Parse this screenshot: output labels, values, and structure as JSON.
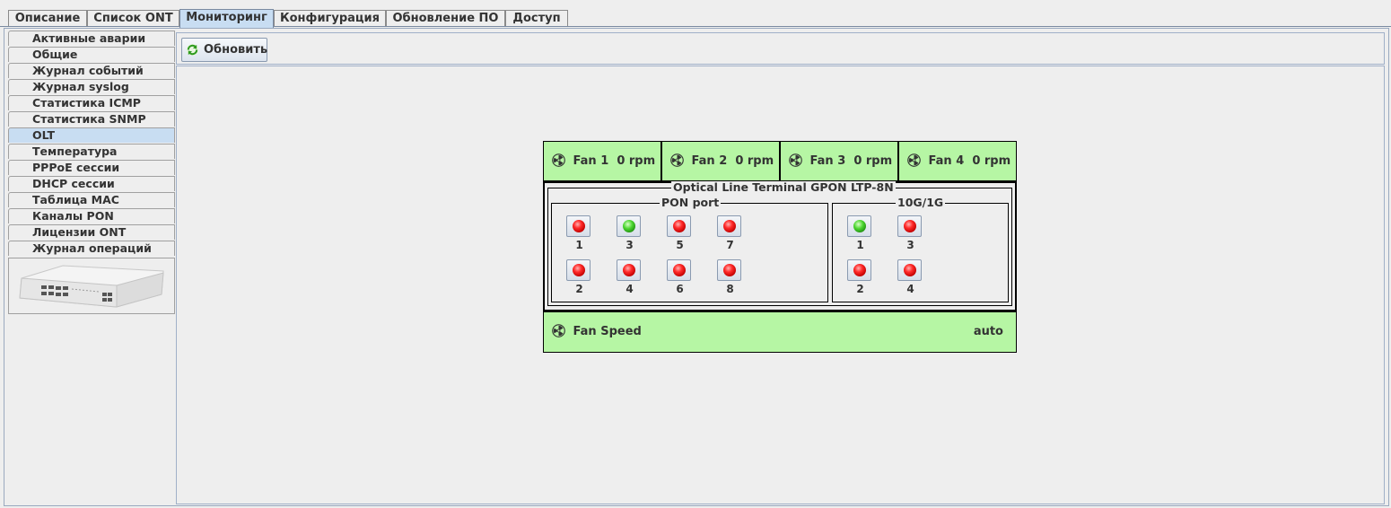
{
  "tabs": [
    {
      "label": "Описание",
      "active": false
    },
    {
      "label": "Список ONT",
      "active": false
    },
    {
      "label": "Мониторинг",
      "active": true
    },
    {
      "label": "Конфигурация",
      "active": false
    },
    {
      "label": "Обновление ПО",
      "active": false
    },
    {
      "label": "Доступ",
      "active": false
    }
  ],
  "sidebar": {
    "items": [
      {
        "label": "Активные аварии",
        "active": false
      },
      {
        "label": "Общие",
        "active": false
      },
      {
        "label": "Журнал событий",
        "active": false
      },
      {
        "label": "Журнал syslog",
        "active": false
      },
      {
        "label": "Статистика ICMP",
        "active": false
      },
      {
        "label": "Статистика SNMP",
        "active": false
      },
      {
        "label": "OLT",
        "active": true
      },
      {
        "label": "Температура",
        "active": false
      },
      {
        "label": "PPPoE сессии",
        "active": false
      },
      {
        "label": "DHCP сессии",
        "active": false
      },
      {
        "label": "Таблица MAC",
        "active": false
      },
      {
        "label": "Каналы PON",
        "active": false
      },
      {
        "label": "Лицензии ONT",
        "active": false
      },
      {
        "label": "Журнал операций",
        "active": false
      }
    ],
    "device_image_icon": "olt-device-image"
  },
  "toolbar": {
    "refresh_label": "Обновить",
    "refresh_icon": "refresh-icon"
  },
  "olt": {
    "fans": [
      {
        "label": "Fan 1",
        "value": "0 rpm"
      },
      {
        "label": "Fan 2",
        "value": "0 rpm"
      },
      {
        "label": "Fan 3",
        "value": "0 rpm"
      },
      {
        "label": "Fan 4",
        "value": "0 rpm"
      }
    ],
    "title": "Optical Line Terminal GPON LTP-8N",
    "pon_group_label": "PON port",
    "pon_ports": [
      {
        "num": "1",
        "status": "red"
      },
      {
        "num": "2",
        "status": "red"
      },
      {
        "num": "3",
        "status": "green"
      },
      {
        "num": "4",
        "status": "red"
      },
      {
        "num": "5",
        "status": "red"
      },
      {
        "num": "6",
        "status": "red"
      },
      {
        "num": "7",
        "status": "red"
      },
      {
        "num": "8",
        "status": "red"
      }
    ],
    "uplink_group_label": "10G/1G",
    "uplink_ports": [
      {
        "num": "1",
        "status": "green"
      },
      {
        "num": "2",
        "status": "red"
      },
      {
        "num": "3",
        "status": "red"
      },
      {
        "num": "4",
        "status": "red"
      }
    ],
    "fan_speed_label": "Fan Speed",
    "fan_speed_value": "auto"
  },
  "colors": {
    "active_tab": "#c8ddf2",
    "fan_panel": "#b6f6a4",
    "led_red": "#ff2a2a",
    "led_green": "#4cd630"
  }
}
